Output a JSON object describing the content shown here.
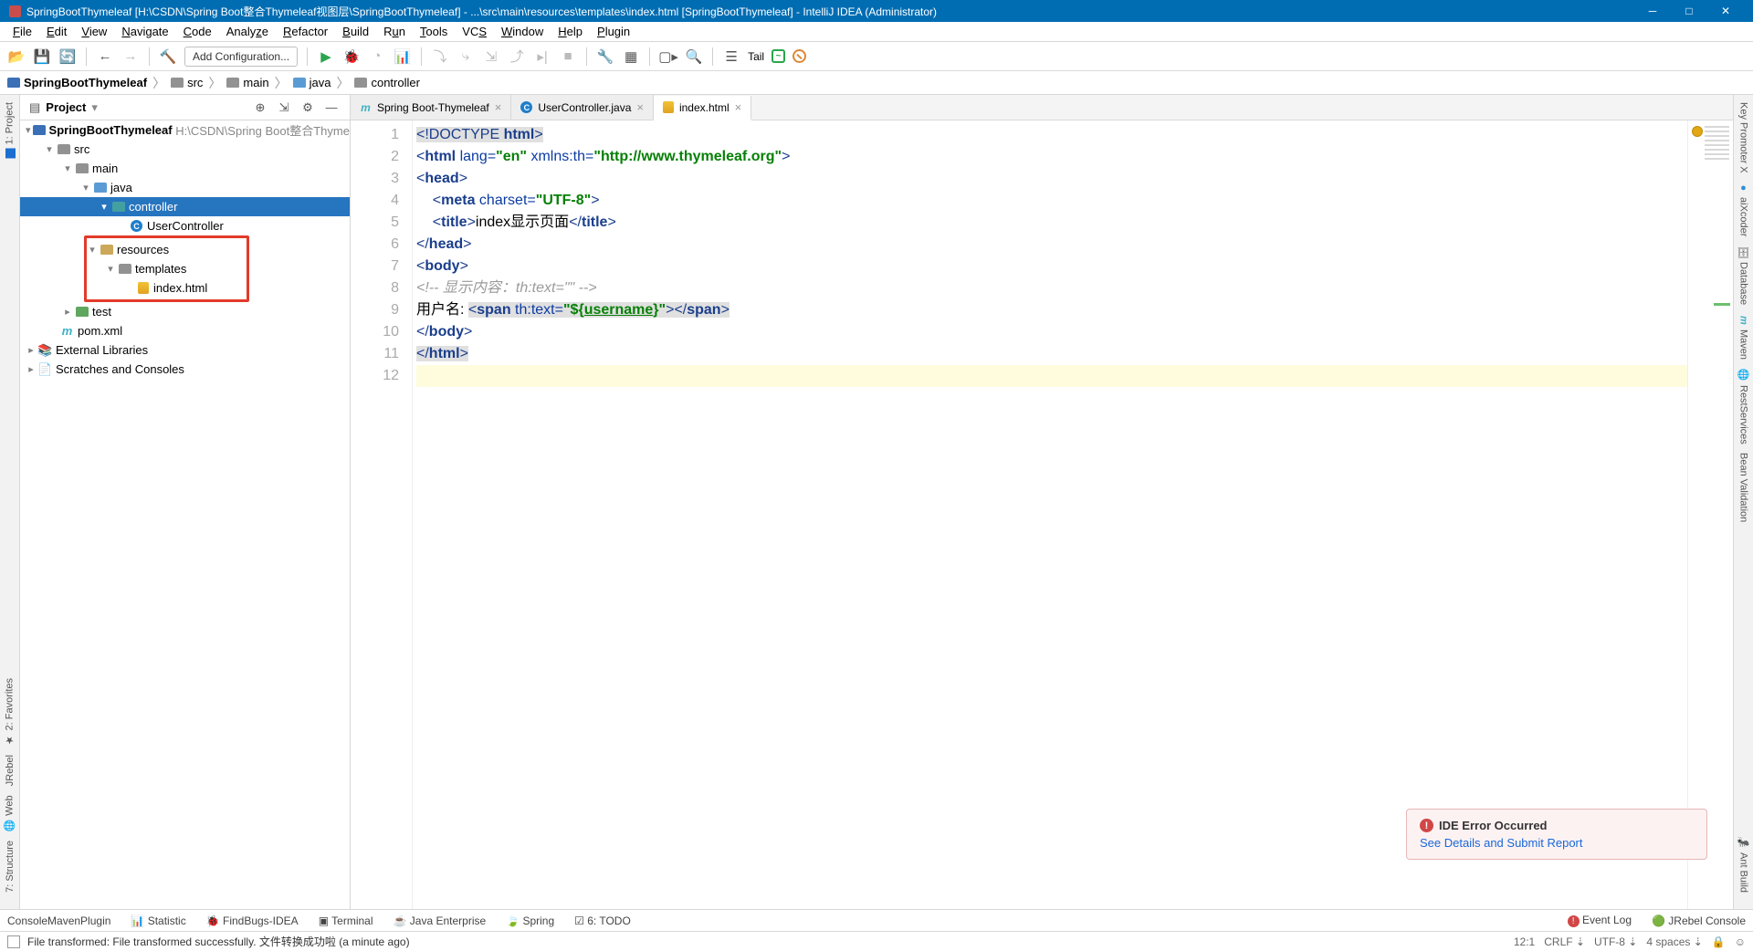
{
  "title": "SpringBootThymeleaf [H:\\CSDN\\Spring Boot整合Thymeleaf视图层\\SpringBootThymeleaf] - ...\\src\\main\\resources\\templates\\index.html [SpringBootThymeleaf] - IntelliJ IDEA (Administrator)",
  "menu": [
    "File",
    "Edit",
    "View",
    "Navigate",
    "Code",
    "Analyze",
    "Refactor",
    "Build",
    "Run",
    "Tools",
    "VCS",
    "Window",
    "Help",
    "Plugin"
  ],
  "runConfig": "Add Configuration...",
  "tailLabel": "Tail",
  "breadcrumbs": [
    "SpringBootThymeleaf",
    "src",
    "main",
    "java",
    "controller"
  ],
  "projectHeader": "Project",
  "tree": {
    "root": "SpringBootThymeleaf",
    "rootPath": "H:\\CSDN\\Spring Boot整合Thymele",
    "src": "src",
    "main": "main",
    "java": "java",
    "controller": "controller",
    "userController": "UserController",
    "resources": "resources",
    "templates": "templates",
    "indexhtml": "index.html",
    "test": "test",
    "pom": "pom.xml",
    "extLib": "External Libraries",
    "scratches": "Scratches and Consoles"
  },
  "tabs": [
    {
      "label": "Spring Boot-Thymeleaf",
      "icon": "m"
    },
    {
      "label": "UserController.java",
      "icon": "c"
    },
    {
      "label": "index.html",
      "icon": "h",
      "active": true
    }
  ],
  "code": {
    "l1a": "<!DOCTYPE ",
    "l1b": "html",
    "l1c": ">",
    "l2a": "<",
    "l2b": "html ",
    "l2c": "lang=",
    "l2d": "\"en\"",
    "l2e": " xmlns:th=",
    "l2f": "\"http://www.thymeleaf.org\"",
    "l2g": ">",
    "l3a": "<",
    "l3b": "head",
    "l3c": ">",
    "l4a": "    <",
    "l4b": "meta ",
    "l4c": "charset=",
    "l4d": "\"UTF-8\"",
    "l4e": ">",
    "l5a": "    <",
    "l5b": "title",
    "l5c": ">",
    "l5d": "index显示页面",
    "l5e": "</",
    "l5f": "title",
    "l5g": ">",
    "l6a": "</",
    "l6b": "head",
    "l6c": ">",
    "l7a": "<",
    "l7b": "body",
    "l7c": ">",
    "l8": "<!-- 显示内容：th:text=\"\" -->",
    "l9a": "用户名: ",
    "l9b": "<",
    "l9c": "span ",
    "l9d": "th:text=",
    "l9e": "\"${",
    "l9f": "username",
    "l9g": "}\"",
    "l9h": "></",
    "l9i": "span",
    "l9j": ">",
    "l10a": "</",
    "l10b": "body",
    "l10c": ">",
    "l11a": "</",
    "l11b": "html",
    "l11c": ">"
  },
  "gutterLines": [
    "1",
    "2",
    "3",
    "4",
    "5",
    "6",
    "7",
    "8",
    "9",
    "10",
    "11",
    "12"
  ],
  "leftSide": {
    "project": "1: Project",
    "favorites": "2: Favorites",
    "jrebel": "JRebel",
    "web": "Web",
    "structure": "7: Structure"
  },
  "rightSide": {
    "key": "Key Promoter X",
    "aix": "aiXcoder",
    "db": "Database",
    "maven": "Maven",
    "rest": "RestServices",
    "ant": "Ant Build",
    "bean": "Bean Validation"
  },
  "bottom": {
    "console": "ConsoleMavenPlugin",
    "stat": "Statistic",
    "findbugs": "FindBugs-IDEA",
    "terminal": "Terminal",
    "javaee": "Java Enterprise",
    "spring": "Spring",
    "todo": "6: TODO",
    "eventlog": "Event Log",
    "jrebel": "JRebel Console"
  },
  "errPopup": {
    "title": "IDE Error Occurred",
    "link": "See Details and Submit Report"
  },
  "status": {
    "msg": "File transformed: File transformed successfully. 文件转换成功啦 (a minute ago)",
    "pos": "12:1",
    "crlf": "CRLF",
    "enc": "UTF-8",
    "indent": "4 spaces"
  }
}
